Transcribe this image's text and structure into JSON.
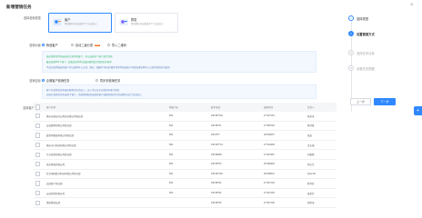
{
  "title": "新增营销任务",
  "close": "×",
  "labels": {
    "type": "选择营销类型",
    "target": "营销目标",
    "task": "营销对象",
    "list": "选择客户"
  },
  "cards": [
    {
      "title": "客户",
      "desc": "将营销任务分配给多个门店或员工"
    },
    {
      "title": "群发",
      "desc": "将营销任务分配给多个门店或员工"
    }
  ],
  "radios": [
    {
      "label": "筛选客户",
      "checked": true,
      "tag": ""
    },
    {
      "label": "自动二级分类",
      "checked": false,
      "tag": "New"
    },
    {
      "label": "导入二维码",
      "checked": false,
      "tag": ""
    }
  ],
  "info1": {
    "lines": [
      "通过搜索条件筛选出符合条件的客户，可以选择多个客户进行营销",
      "最多选择500个客户，超出部分将不会被分配到此次营销任务当中",
      "不适合使用筛选的客户可以使用导入方式，例如：根据行为标签/属性等条件筛选客户时请选择使用导入方式的营销任务类型"
    ]
  },
  "target": {
    "option1": "企微客户营销任务",
    "option2": "同步到营销任务"
  },
  "info2": {
    "lines": [
      "客户在营销任务中被分配到对应的员工，员工可以在企业微信中进行营销",
      "如您在营销任务中选择了客户，系统将按照您选择的客户创建营销任务并分配给对应门店或员工"
    ]
  },
  "table": {
    "headers": [
      "",
      "客户名称",
      "所属门店",
      "联系电话",
      "更新时间",
      "负责人"
    ],
    "rows": [
      [
        "",
        "惠州市商业办公用品有限公司营业部",
        "500",
        "156.89*134",
        "27.547191",
        "陈美金"
      ],
      [
        "",
        "宏达建材有限公司营业部",
        "500",
        "156.89*01",
        "27.550746",
        "林诗意"
      ],
      [
        "",
        "爱思特眼镜有限公司营业部",
        "500",
        "156.8*0*",
        "28.549037",
        "张良"
      ],
      [
        "",
        "惠州市大科技有限公司营业部",
        "500",
        "156.667*01",
        "27.514609",
        "王志强"
      ],
      [
        "",
        "东方商贸有限公司营业部",
        "500",
        "156.89660",
        "27.547957",
        "刘俊德"
      ],
      [
        "",
        "南方物流有限公司",
        "500",
        "156.89*00",
        "28.569946",
        "邓志军"
      ],
      [
        "",
        "北京国际联合科技有限公司营业部",
        "500",
        "156.89*146",
        "28.599631",
        "Qwerdd"
      ],
      [
        "",
        "迈达客户营业部",
        "500",
        "156.89*94",
        "27.547126",
        "陈可欣"
      ],
      [
        "",
        "宏达商贸有限公司",
        "500",
        "156.89*94",
        "27.547106",
        "黄美玲"
      ],
      [
        "",
        "博达惠营业部",
        "",
        "156.89*09",
        "27.547106",
        "郭美玉"
      ]
    ]
  },
  "steps": [
    {
      "num": "1",
      "label": "选择类型",
      "state": "done"
    },
    {
      "num": "2",
      "label": "设置营销方式",
      "state": "active"
    },
    {
      "num": "3",
      "label": "选择任务对象",
      "state": "todo"
    },
    {
      "num": "4",
      "label": "设置任务提醒",
      "state": "todo"
    }
  ],
  "buttons": {
    "prev": "上一步",
    "next": "下一步"
  },
  "fab": "+"
}
